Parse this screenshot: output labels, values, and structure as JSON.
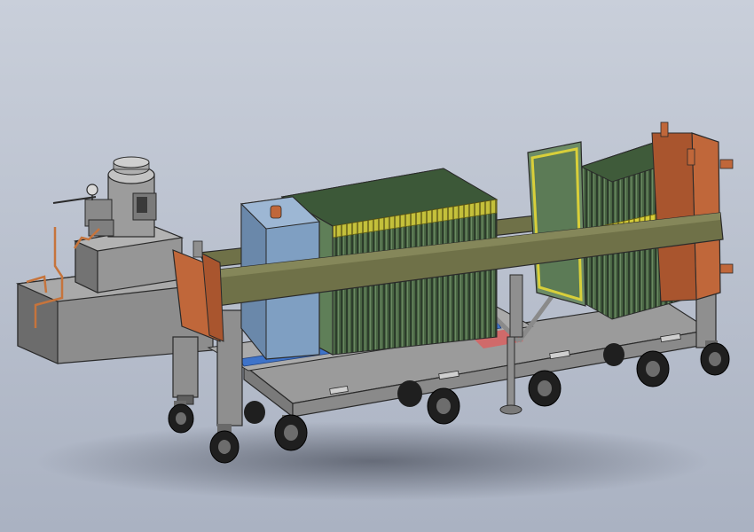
{
  "scene": {
    "subject": "filter-press-on-mobile-cart",
    "background": {
      "top": "#c9cfda",
      "bottom": "#aab2c2"
    },
    "colors": {
      "frame_beam": "#6f7148",
      "steel_gray": "#9a9a9a",
      "steel_dark": "#6e6e6e",
      "plates_green": "#4f6f4a",
      "plates_yellow": "#d8cf3a",
      "head_blue": "#7f9fc2",
      "end_plate_copper": "#c0673a",
      "wheel_black": "#1f1f1f",
      "pipe_copper": "#c6743c",
      "floor_red": "#d06a6a",
      "floor_blue": "#3e73c9"
    }
  }
}
